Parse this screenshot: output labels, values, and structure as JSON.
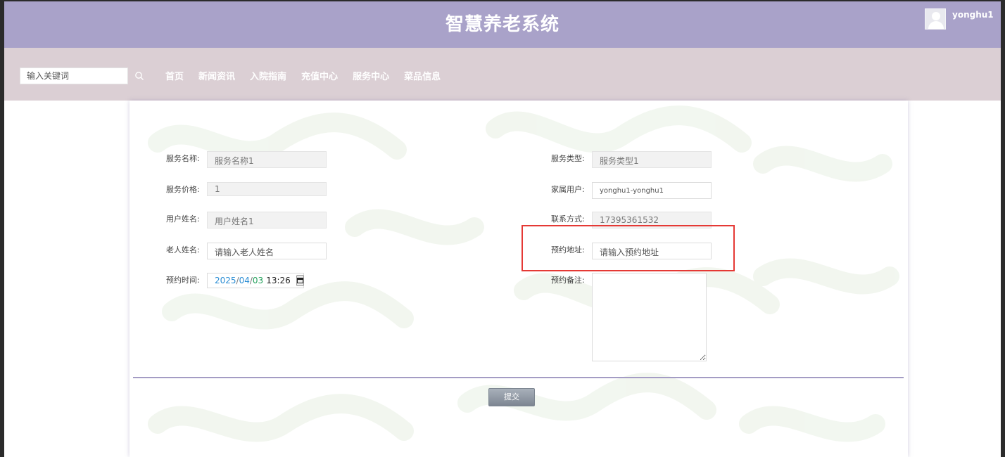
{
  "header": {
    "title": "智慧养老系统",
    "username": "yonghu1"
  },
  "search": {
    "placeholder": "输入关键词"
  },
  "nav": [
    "首页",
    "新闻资讯",
    "入院指南",
    "充值中心",
    "服务中心",
    "菜品信息"
  ],
  "form": {
    "service_name": {
      "label": "服务名称:",
      "value": "服务名称1"
    },
    "service_type": {
      "label": "服务类型:",
      "value": "服务类型1"
    },
    "service_price": {
      "label": "服务价格:",
      "value": "1"
    },
    "family_user": {
      "label": "家属用户:",
      "value": "yonghu1-yonghu1"
    },
    "user_name": {
      "label": "用户姓名:",
      "value": "用户姓名1"
    },
    "contact": {
      "label": "联系方式:",
      "value": "17395361532"
    },
    "elder_name": {
      "label": "老人姓名:",
      "placeholder": "请输入老人姓名"
    },
    "address": {
      "label": "预约地址:",
      "placeholder": "请输入预约地址"
    },
    "time": {
      "label": "预约时间:",
      "year": "2025",
      "month": "04",
      "day": "03",
      "sep": "/",
      "clock": "13:26"
    },
    "remarks": {
      "label": "预约备注:"
    },
    "submit_label": "提交"
  },
  "colors": {
    "header": "#a9a2c9",
    "nav": "#dbcfd4",
    "highlight": "#e53935",
    "divider": "#a49cc4"
  }
}
